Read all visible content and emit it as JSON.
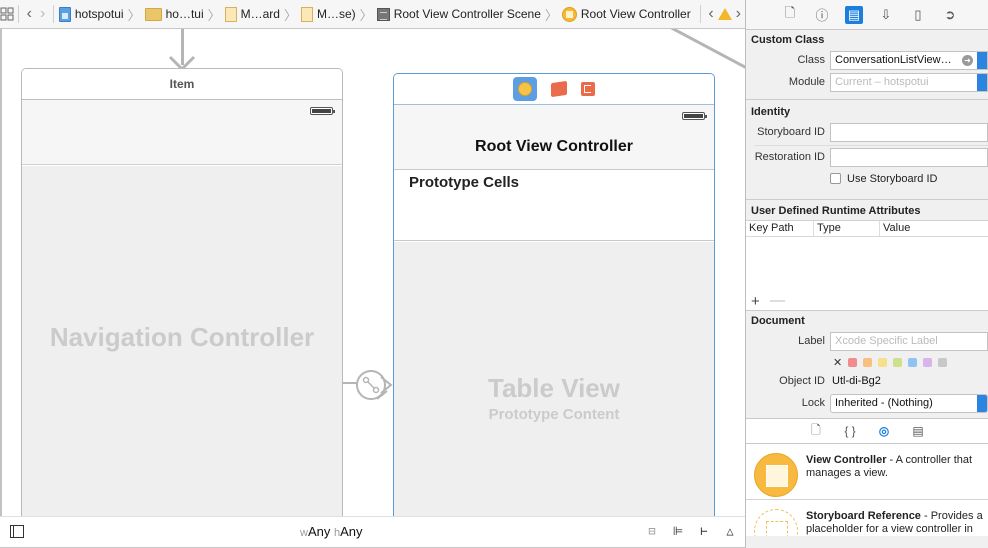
{
  "jumpbar": {
    "crumbs": [
      {
        "label": "hotspotui",
        "icon": "project-file-icon"
      },
      {
        "label": "ho…tui",
        "icon": "folder-icon"
      },
      {
        "label": "M…ard",
        "icon": "storyboard-icon"
      },
      {
        "label": "M…se)",
        "icon": "storyboard-icon"
      },
      {
        "label": "Root View Controller Scene",
        "icon": "scene-icon"
      },
      {
        "label": "Root View Controller",
        "icon": "view-controller-icon"
      }
    ]
  },
  "canvas": {
    "nav_scene": {
      "header": "Item",
      "title": "Navigation Controller"
    },
    "root_scene": {
      "nav_title": "Root View Controller",
      "section": "Prototype Cells",
      "table_title": "Table View",
      "table_subtitle": "Prototype Content"
    }
  },
  "bottombar": {
    "w_prefix": "w",
    "w_value": "Any",
    "h_prefix": "h",
    "h_value": "Any"
  },
  "inspector": {
    "custom_class": {
      "title": "Custom Class",
      "class_label": "Class",
      "class_value": "ConversationListView…",
      "module_label": "Module",
      "module_placeholder": "Current – hotspotui"
    },
    "identity": {
      "title": "Identity",
      "storyboard_id_label": "Storyboard ID",
      "storyboard_id_value": "",
      "restoration_id_label": "Restoration ID",
      "restoration_id_value": "",
      "use_storyboard_id_label": "Use Storyboard ID",
      "use_storyboard_id_checked": false
    },
    "runtime_attributes": {
      "title": "User Defined Runtime Attributes",
      "columns": [
        "Key Path",
        "Type",
        "Value"
      ],
      "rows": []
    },
    "document": {
      "title": "Document",
      "label_label": "Label",
      "label_placeholder": "Xcode Specific Label",
      "colors": [
        "#f08c8c",
        "#f7c07f",
        "#f6e08a",
        "#cde08a",
        "#8fc3f2",
        "#d9b3ec",
        "#c8c8c8"
      ],
      "object_id_label": "Object ID",
      "object_id_value": "Utl-di-Bg2",
      "lock_label": "Lock",
      "lock_value": "Inherited - (Nothing)"
    },
    "library": {
      "items": [
        {
          "name": "View Controller",
          "desc": " - A controller that manages a view."
        },
        {
          "name": "Storyboard Reference",
          "desc": " - Provides a placeholder for a view controller in an external storyboard."
        }
      ]
    }
  }
}
